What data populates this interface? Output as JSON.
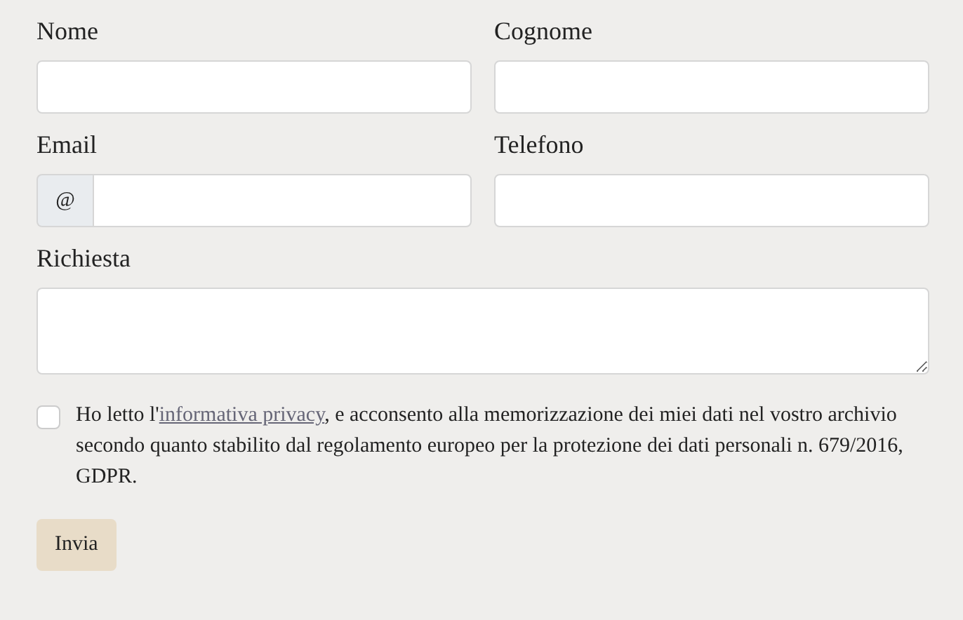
{
  "fields": [
    {
      "label": "Nome",
      "kind": "text"
    },
    {
      "label": "Cognome",
      "kind": "text"
    },
    {
      "label": "Email",
      "kind": "prefixed",
      "prefix": "@"
    },
    {
      "label": "Telefono",
      "kind": "text"
    },
    {
      "label": "Richiesta",
      "kind": "textarea"
    }
  ],
  "consent": {
    "checked": false,
    "before": "Ho letto l'",
    "link": "informativa privacy",
    "after": ", e acconsento alla memorizzazione dei miei dati nel vostro archivio secondo quanto stabilito dal regolamento europeo per la protezione dei dati personali n. 679/2016, GDPR."
  },
  "submit": "Invia"
}
